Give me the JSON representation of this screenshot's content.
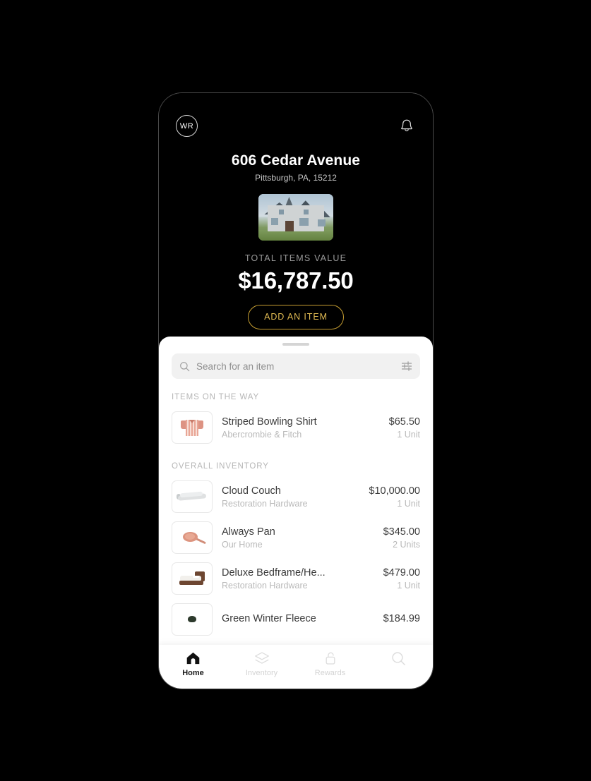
{
  "header": {
    "avatar_initials": "WR",
    "notification_icon": "bell-icon"
  },
  "property": {
    "title": "606 Cedar Avenue",
    "address": "Pittsburgh, PA, 15212",
    "photo_alt": "house-photo"
  },
  "summary": {
    "total_label": "TOTAL ITEMS VALUE",
    "total_value": "$16,787.50",
    "add_item_label": "ADD AN ITEM",
    "accent_color": "#c79f32"
  },
  "search": {
    "placeholder": "Search for an item",
    "value": "",
    "search_icon": "search-icon",
    "filter_icon": "filter-sliders-icon"
  },
  "sections": [
    {
      "heading": "ITEMS ON THE WAY",
      "items": [
        {
          "name": "Striped Bowling Shirt",
          "brand": "Abercrombie & Fitch",
          "price": "$65.50",
          "units": "1 Unit",
          "thumb": "shirt-thumbnail"
        }
      ]
    },
    {
      "heading": "OVERALL INVENTORY",
      "items": [
        {
          "name": "Cloud Couch",
          "brand": "Restoration Hardware",
          "price": "$10,000.00",
          "units": "1 Unit",
          "thumb": "couch-thumbnail"
        },
        {
          "name": "Always Pan",
          "brand": "Our Home",
          "price": "$345.00",
          "units": "2 Units",
          "thumb": "pan-thumbnail"
        },
        {
          "name": "Deluxe Bedframe/He...",
          "brand": "Restoration Hardware",
          "price": "$479.00",
          "units": "1 Unit",
          "thumb": "bed-thumbnail"
        },
        {
          "name": "Green Winter Fleece",
          "brand": "",
          "price": "$184.99",
          "units": "",
          "thumb": "fleece-thumbnail"
        }
      ]
    }
  ],
  "tabbar": [
    {
      "label": "Home",
      "icon": "home-icon",
      "active": true
    },
    {
      "label": "Inventory",
      "icon": "layers-icon",
      "active": false
    },
    {
      "label": "Rewards",
      "icon": "unlocked-padlock-icon",
      "active": false
    },
    {
      "label": "",
      "icon": "search-icon",
      "active": false
    }
  ]
}
